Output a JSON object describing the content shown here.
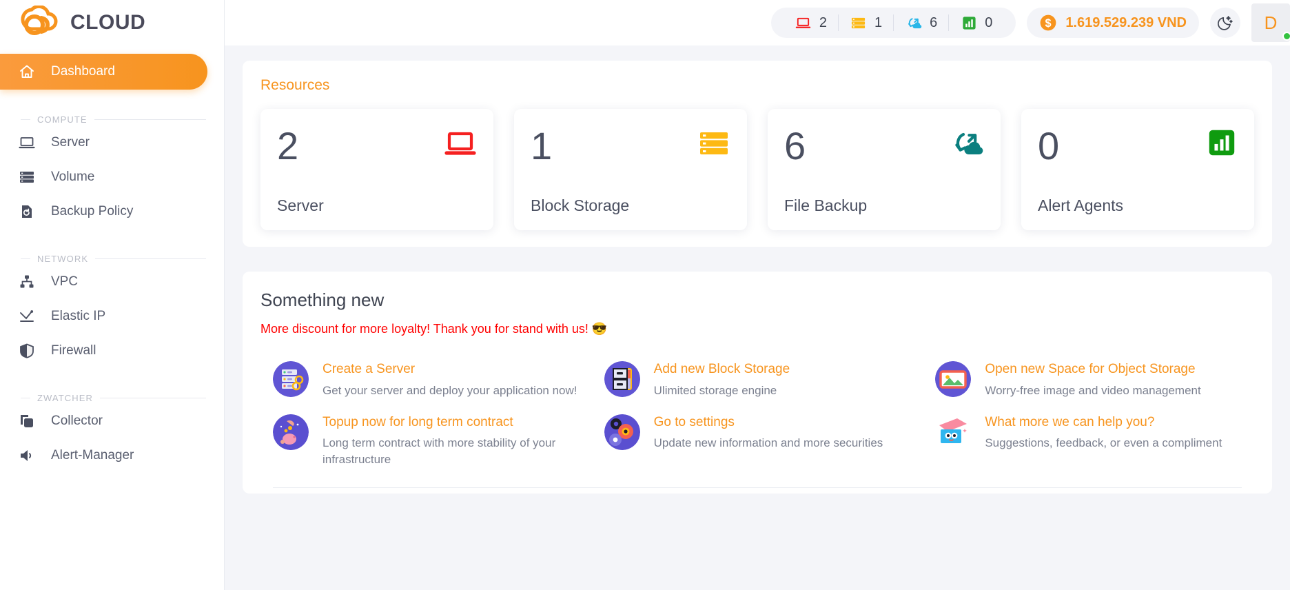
{
  "brand": {
    "name": "CLOUD",
    "logo_icon": "cloud-logo-icon"
  },
  "sidebar": {
    "active": {
      "label": "Dashboard",
      "icon": "home-icon"
    },
    "sections": [
      {
        "title": "COMPUTE",
        "items": [
          {
            "label": "Server",
            "icon": "laptop-icon"
          },
          {
            "label": "Volume",
            "icon": "server-stack-icon"
          },
          {
            "label": "Backup Policy",
            "icon": "backup-restore-icon"
          }
        ]
      },
      {
        "title": "NETWORK",
        "items": [
          {
            "label": "VPC",
            "icon": "network-topology-icon"
          },
          {
            "label": "Elastic IP",
            "icon": "elastic-ip-icon"
          },
          {
            "label": "Firewall",
            "icon": "shield-icon"
          }
        ]
      },
      {
        "title": "ZWATCHER",
        "items": [
          {
            "label": "Collector",
            "icon": "copy-layers-icon"
          },
          {
            "label": "Alert-Manager",
            "icon": "speaker-icon"
          }
        ]
      }
    ]
  },
  "topbar": {
    "stats": [
      {
        "icon": "laptop-icon",
        "count": "2",
        "color": "#f52020"
      },
      {
        "icon": "server-stack-icon",
        "count": "1",
        "color": "#fdb913"
      },
      {
        "icon": "cloud-backup-icon",
        "count": "6",
        "color": "#29b6e8"
      },
      {
        "icon": "bar-chart-icon",
        "count": "0",
        "color": "#2eaa38"
      }
    ],
    "balance": {
      "icon": "dollar-coin-icon",
      "amount": "1.619.529.239 VND"
    },
    "theme_toggle_icon": "moon-stars-icon",
    "avatar": {
      "initial": "D",
      "status": "online"
    }
  },
  "resources": {
    "title": "Resources",
    "cards": [
      {
        "value": "2",
        "label": "Server",
        "icon": "laptop-icon",
        "color": "#f52020"
      },
      {
        "value": "1",
        "label": "Block Storage",
        "icon": "server-stack-icon",
        "color": "#fdb913"
      },
      {
        "value": "6",
        "label": "File Backup",
        "icon": "cloud-backup-icon",
        "color": "#0b7f7f"
      },
      {
        "value": "0",
        "label": "Alert Agents",
        "icon": "bar-chart-icon",
        "color": "#0f9b0f"
      }
    ]
  },
  "something_new": {
    "title": "Something new",
    "promo": "More discount for more loyalty! Thank you for stand with us! 😎",
    "links": [
      {
        "title": "Create a Server",
        "desc": "Get your server and deploy your application now!",
        "icon": "server-rack-illustration"
      },
      {
        "title": "Add new Block Storage",
        "desc": "Ulimited storage engine",
        "icon": "storage-drawer-illustration"
      },
      {
        "title": "Open new Space for Object Storage",
        "desc": "Worry-free image and video management",
        "icon": "photo-frame-illustration"
      },
      {
        "title": "Topup now for long term contract",
        "desc": "Long term contract with more stability of your infrastructure",
        "icon": "piggy-bank-illustration"
      },
      {
        "title": "Go to settings",
        "desc": "Update new information and more securities",
        "icon": "gears-illustration"
      },
      {
        "title": "What more we can help you?",
        "desc": "Suggestions, feedback, or even a compliment",
        "icon": "feedback-box-illustration"
      }
    ]
  },
  "colors": {
    "accent": "#f7941e",
    "text": "#4a4f60",
    "muted": "#7c8190",
    "alert": "#ff0000",
    "online": "#34c240"
  }
}
